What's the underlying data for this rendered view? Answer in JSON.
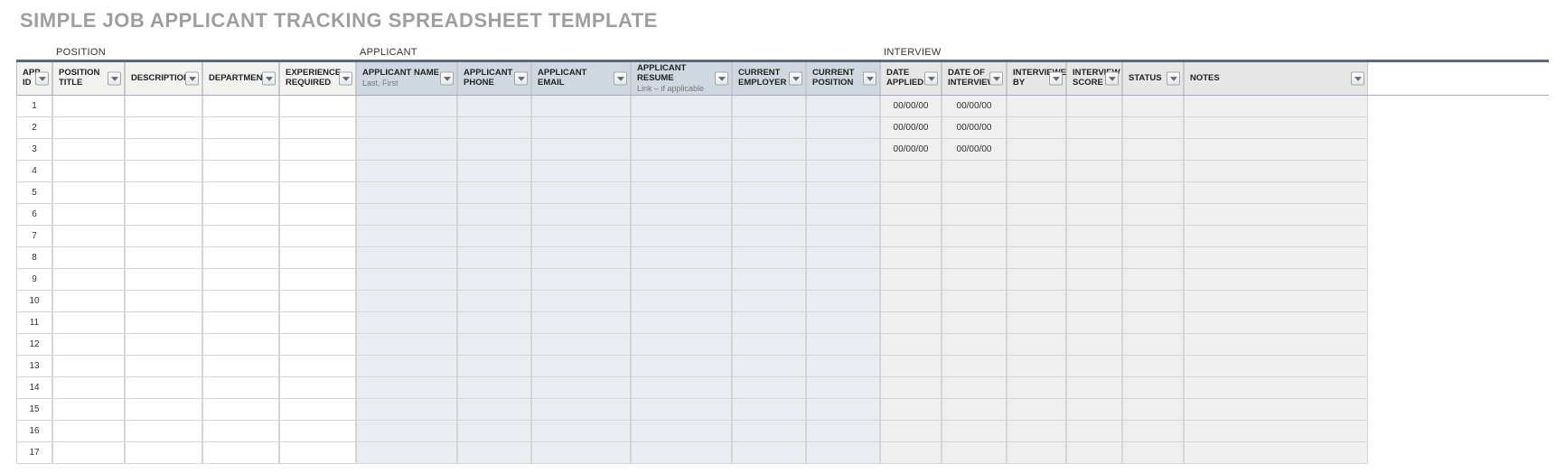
{
  "title": "SIMPLE JOB APPLICANT TRACKING SPREADSHEET TEMPLATE",
  "sections": {
    "position": "POSITION",
    "applicant": "APPLICANT",
    "interview": "INTERVIEW"
  },
  "columns": [
    {
      "label": "APP. ID",
      "sub": ""
    },
    {
      "label": "POSITION TITLE",
      "sub": ""
    },
    {
      "label": "DESCRIPTION",
      "sub": ""
    },
    {
      "label": "DEPARTMENT",
      "sub": ""
    },
    {
      "label": "EXPERIENCE REQUIRED",
      "sub": ""
    },
    {
      "label": "APPLICANT NAME",
      "sub": "Last, First"
    },
    {
      "label": "APPLICANT PHONE",
      "sub": ""
    },
    {
      "label": "APPLICANT EMAIL",
      "sub": ""
    },
    {
      "label": "APPLICANT RESUME",
      "sub": "Link – if applicable"
    },
    {
      "label": "CURRENT EMPLOYER",
      "sub": ""
    },
    {
      "label": "CURRENT POSITION",
      "sub": ""
    },
    {
      "label": "DATE APPLIED",
      "sub": ""
    },
    {
      "label": "DATE OF INTERVIEW",
      "sub": ""
    },
    {
      "label": "INTERVIEWED BY",
      "sub": ""
    },
    {
      "label": "INTERVIEW SCORE",
      "sub": ""
    },
    {
      "label": "STATUS",
      "sub": ""
    },
    {
      "label": "NOTES",
      "sub": ""
    }
  ],
  "rows": [
    {
      "id": "1",
      "date_applied": "00/00/00",
      "date_interview": "00/00/00"
    },
    {
      "id": "2",
      "date_applied": "00/00/00",
      "date_interview": "00/00/00"
    },
    {
      "id": "3",
      "date_applied": "00/00/00",
      "date_interview": "00/00/00"
    },
    {
      "id": "4",
      "date_applied": "",
      "date_interview": ""
    },
    {
      "id": "5",
      "date_applied": "",
      "date_interview": ""
    },
    {
      "id": "6",
      "date_applied": "",
      "date_interview": ""
    },
    {
      "id": "7",
      "date_applied": "",
      "date_interview": ""
    },
    {
      "id": "8",
      "date_applied": "",
      "date_interview": ""
    },
    {
      "id": "9",
      "date_applied": "",
      "date_interview": ""
    },
    {
      "id": "10",
      "date_applied": "",
      "date_interview": ""
    },
    {
      "id": "11",
      "date_applied": "",
      "date_interview": ""
    },
    {
      "id": "12",
      "date_applied": "",
      "date_interview": ""
    },
    {
      "id": "13",
      "date_applied": "",
      "date_interview": ""
    },
    {
      "id": "14",
      "date_applied": "",
      "date_interview": ""
    },
    {
      "id": "15",
      "date_applied": "",
      "date_interview": ""
    },
    {
      "id": "16",
      "date_applied": "",
      "date_interview": ""
    },
    {
      "id": "17",
      "date_applied": "",
      "date_interview": ""
    }
  ]
}
